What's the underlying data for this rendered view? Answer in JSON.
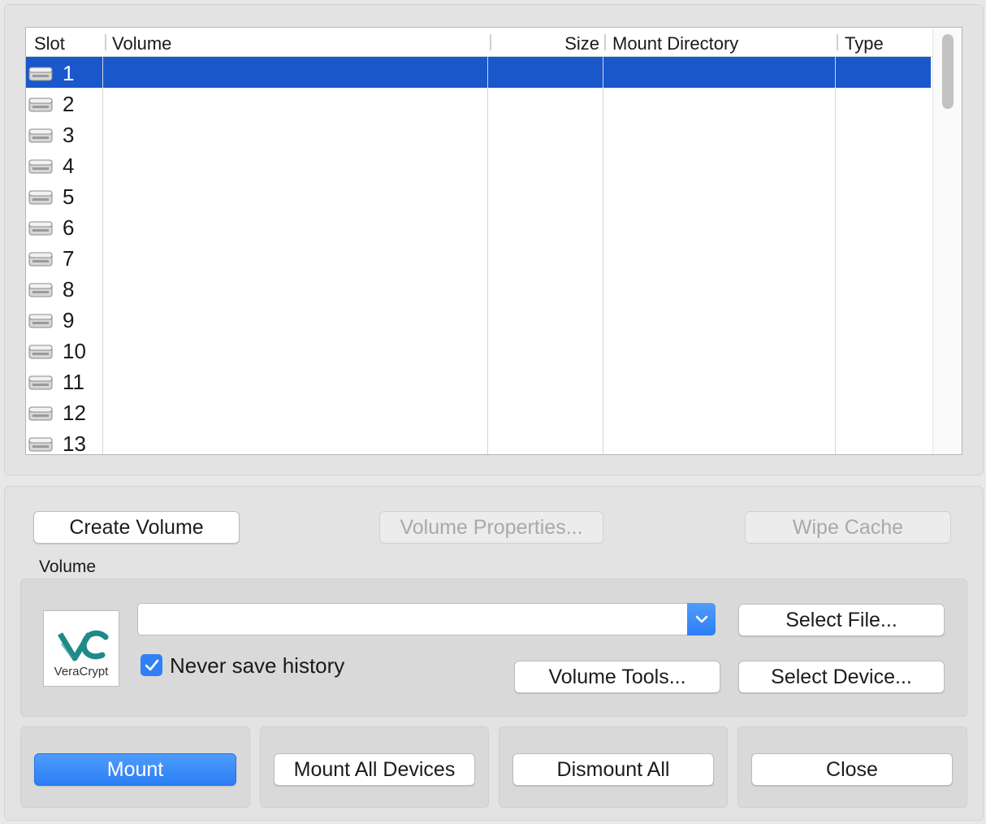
{
  "table": {
    "columns": [
      "Slot",
      "Volume",
      "Size",
      "Mount Directory",
      "Type"
    ],
    "rows": [
      {
        "slot": "1",
        "selected": true
      },
      {
        "slot": "2"
      },
      {
        "slot": "3"
      },
      {
        "slot": "4"
      },
      {
        "slot": "5"
      },
      {
        "slot": "6"
      },
      {
        "slot": "7"
      },
      {
        "slot": "8"
      },
      {
        "slot": "9"
      },
      {
        "slot": "10"
      },
      {
        "slot": "11"
      },
      {
        "slot": "12"
      },
      {
        "slot": "13"
      }
    ],
    "row_icon": "drive-icon"
  },
  "toolbar": {
    "create_volume": "Create Volume",
    "volume_properties": "Volume Properties...",
    "wipe_cache": "Wipe Cache"
  },
  "volume": {
    "group_label": "Volume",
    "path_value": "",
    "never_save_history_label": "Never save history",
    "never_save_history_checked": true,
    "select_file": "Select File...",
    "volume_tools": "Volume Tools...",
    "select_device": "Select Device...",
    "logo_text": "VeraCrypt"
  },
  "actions": {
    "mount": "Mount",
    "mount_all_devices": "Mount All Devices",
    "dismount_all": "Dismount All",
    "close": "Close"
  },
  "colors": {
    "selection": "#1957cb",
    "accent": "#2f7ff6",
    "logo_teal": "#1f8a8a"
  }
}
